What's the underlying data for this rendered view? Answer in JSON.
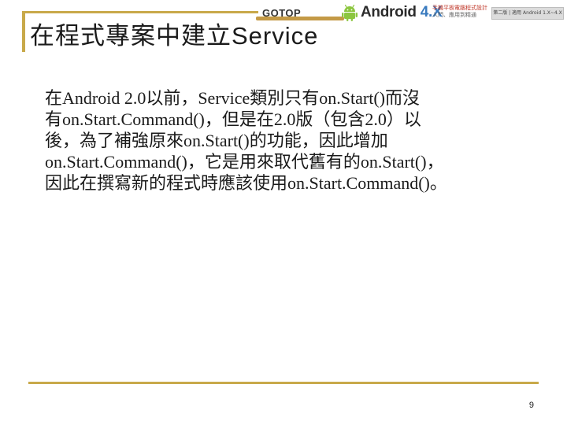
{
  "slide": {
    "title_cjk": "在程式專案中建立",
    "title_latin": "Service",
    "body_lines": [
      "在Android 2.0以前，Service類別只有on.Start()而沒",
      "有on.Start.Command()，但是在2.0版（包含2.0）以",
      "後，為了補強原來on.Start()的功能，因此增加",
      "on.Start.Command()，它是用來取代舊有的on.Start()，",
      "因此在撰寫新的程式時應該使用on.Start.Command()。"
    ],
    "page_number": "9"
  },
  "banner": {
    "publisher": "GOTOP",
    "product_name": "Android",
    "product_version": "4.X",
    "sub_line1": "手機平板電腦程式設計",
    "sub_line2": "入門、應用到精通",
    "chapter_tag": "第二版 | 適用 Android 1.X~4.X"
  },
  "colors": {
    "accent_gold": "#c8a94a",
    "text": "#1a1a1a",
    "android_blue": "#3a7bbf",
    "android_green": "#8cc63f"
  },
  "icons": {
    "banner_logo": "android-robot-icon"
  }
}
